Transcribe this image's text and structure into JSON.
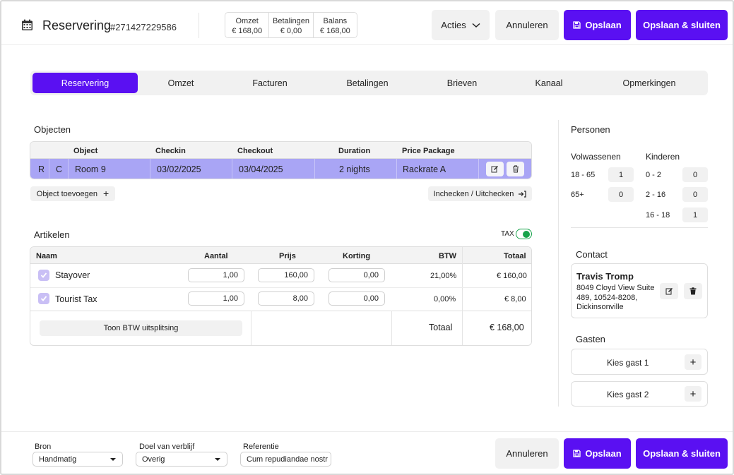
{
  "header": {
    "title": "Reservering",
    "reservation_number": "#271427229586",
    "stats": [
      {
        "label": "Omzet",
        "value": "€ 168,00"
      },
      {
        "label": "Betalingen",
        "value": "€ 0,00"
      },
      {
        "label": "Balans",
        "value": "€ 168,00"
      }
    ],
    "actions_label": "Acties",
    "cancel_label": "Annuleren",
    "save_label": "Opslaan",
    "save_close_label": "Opslaan & sluiten"
  },
  "tabs": [
    "Reservering",
    "Omzet",
    "Facturen",
    "Betalingen",
    "Brieven",
    "Kanaal",
    "Opmerkingen"
  ],
  "objects": {
    "title": "Objecten",
    "columns": [
      "Object",
      "Checkin",
      "Checkout",
      "Duration",
      "Price Package"
    ],
    "row": {
      "r": "R",
      "c": "C",
      "object": "Room 9",
      "checkin": "03/02/2025",
      "checkout": "03/04/2025",
      "duration": "2 nights",
      "package": "Rackrate A"
    },
    "add_label": "Object toevoegen",
    "checkin_label": "Inchecken / Uitchecken"
  },
  "articles": {
    "title": "Artikelen",
    "tax_label": "TAX",
    "columns": [
      "Naam",
      "Aantal",
      "Prijs",
      "Korting",
      "BTW",
      "Totaal"
    ],
    "rows": [
      {
        "name": "Stayover",
        "qty": "1,00",
        "price": "160,00",
        "discount": "0,00",
        "vat": "21,00%",
        "total": "€ 160,00"
      },
      {
        "name": "Tourist Tax",
        "qty": "1,00",
        "price": "8,00",
        "discount": "0,00",
        "vat": "0,00%",
        "total": "€ 8,00"
      }
    ],
    "vat_split_label": "Toon BTW uitsplitsing",
    "total_label": "Totaal",
    "total_value": "€ 168,00"
  },
  "persons": {
    "title": "Personen",
    "adults_label": "Volwassenen",
    "children_label": "Kinderen",
    "adults": [
      {
        "range": "18 - 65",
        "count": "1"
      },
      {
        "range": "65+",
        "count": "0"
      }
    ],
    "children": [
      {
        "range": "0 - 2",
        "count": "0"
      },
      {
        "range": "2 - 16",
        "count": "0"
      },
      {
        "range": "16 - 18",
        "count": "1"
      }
    ]
  },
  "contact": {
    "title": "Contact",
    "name": "Travis Tromp",
    "address_line1": "8049 Cloyd View Suite",
    "address_line2": "489, 10524-8208,",
    "address_line3": "Dickinsonville"
  },
  "guests": {
    "title": "Gasten",
    "items": [
      "Kies gast 1",
      "Kies gast 2"
    ]
  },
  "footer": {
    "source_label": "Bron",
    "source_value": "Handmatig",
    "purpose_label": "Doel van verblijf",
    "purpose_value": "Overig",
    "reference_label": "Referentie",
    "reference_value": "Cum repudiandae nostr",
    "cancel_label": "Annuleren",
    "save_label": "Opslaan",
    "save_close_label": "Opslaan & sluiten"
  },
  "colors": {
    "accent": "#5a10f2",
    "row_highlight": "#a9a5f5",
    "toggle": "#16a34a"
  }
}
